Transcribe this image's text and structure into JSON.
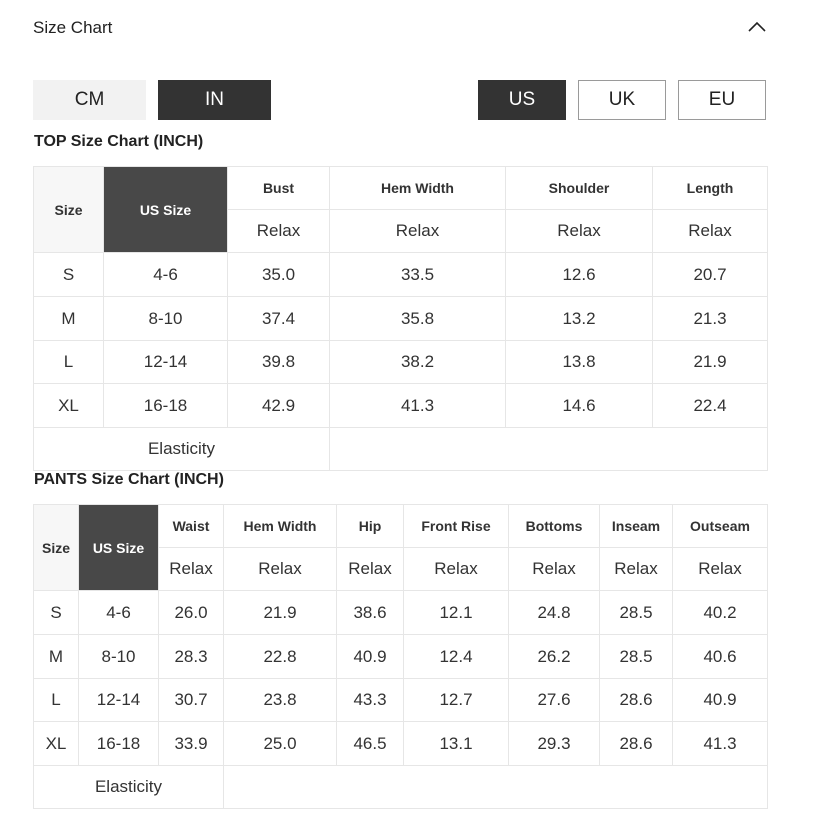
{
  "header": {
    "title": "Size Chart",
    "collapse_icon": "chevron-up-icon"
  },
  "units": {
    "cm_label": "CM",
    "in_label": "IN",
    "active": "IN"
  },
  "regions": {
    "us_label": "US",
    "uk_label": "UK",
    "eu_label": "EU",
    "active": "US"
  },
  "colors": {
    "active_bg": "#333333",
    "us_column_bg": "#484848",
    "inactive_unit_bg": "#f2f2f2",
    "border": "#e6e6e6"
  },
  "top": {
    "title": "TOP Size Chart (INCH)",
    "headers": [
      "Size",
      "US Size",
      "Bust",
      "Hem Width",
      "Shoulder",
      "Length"
    ],
    "sub": [
      "Relax",
      "Relax",
      "Relax",
      "Relax"
    ],
    "rows": [
      [
        "S",
        "4-6",
        "35.0",
        "33.5",
        "12.6",
        "20.7"
      ],
      [
        "M",
        "8-10",
        "37.4",
        "35.8",
        "13.2",
        "21.3"
      ],
      [
        "L",
        "12-14",
        "39.8",
        "38.2",
        "13.8",
        "21.9"
      ],
      [
        "XL",
        "16-18",
        "42.9",
        "41.3",
        "14.6",
        "22.4"
      ]
    ],
    "footer_label": "Elasticity"
  },
  "pants": {
    "title": "PANTS Size Chart (INCH)",
    "headers": [
      "Size",
      "US Size",
      "Waist",
      "Hem Width",
      "Hip",
      "Front Rise",
      "Bottoms",
      "Inseam",
      "Outseam"
    ],
    "sub": [
      "Relax",
      "Relax",
      "Relax",
      "Relax",
      "Relax",
      "Relax",
      "Relax"
    ],
    "rows": [
      [
        "S",
        "4-6",
        "26.0",
        "21.9",
        "38.6",
        "12.1",
        "24.8",
        "28.5",
        "40.2"
      ],
      [
        "M",
        "8-10",
        "28.3",
        "22.8",
        "40.9",
        "12.4",
        "26.2",
        "28.5",
        "40.6"
      ],
      [
        "L",
        "12-14",
        "30.7",
        "23.8",
        "43.3",
        "12.7",
        "27.6",
        "28.6",
        "40.9"
      ],
      [
        "XL",
        "16-18",
        "33.9",
        "25.0",
        "46.5",
        "13.1",
        "29.3",
        "28.6",
        "41.3"
      ]
    ],
    "footer_label": "Elasticity"
  }
}
